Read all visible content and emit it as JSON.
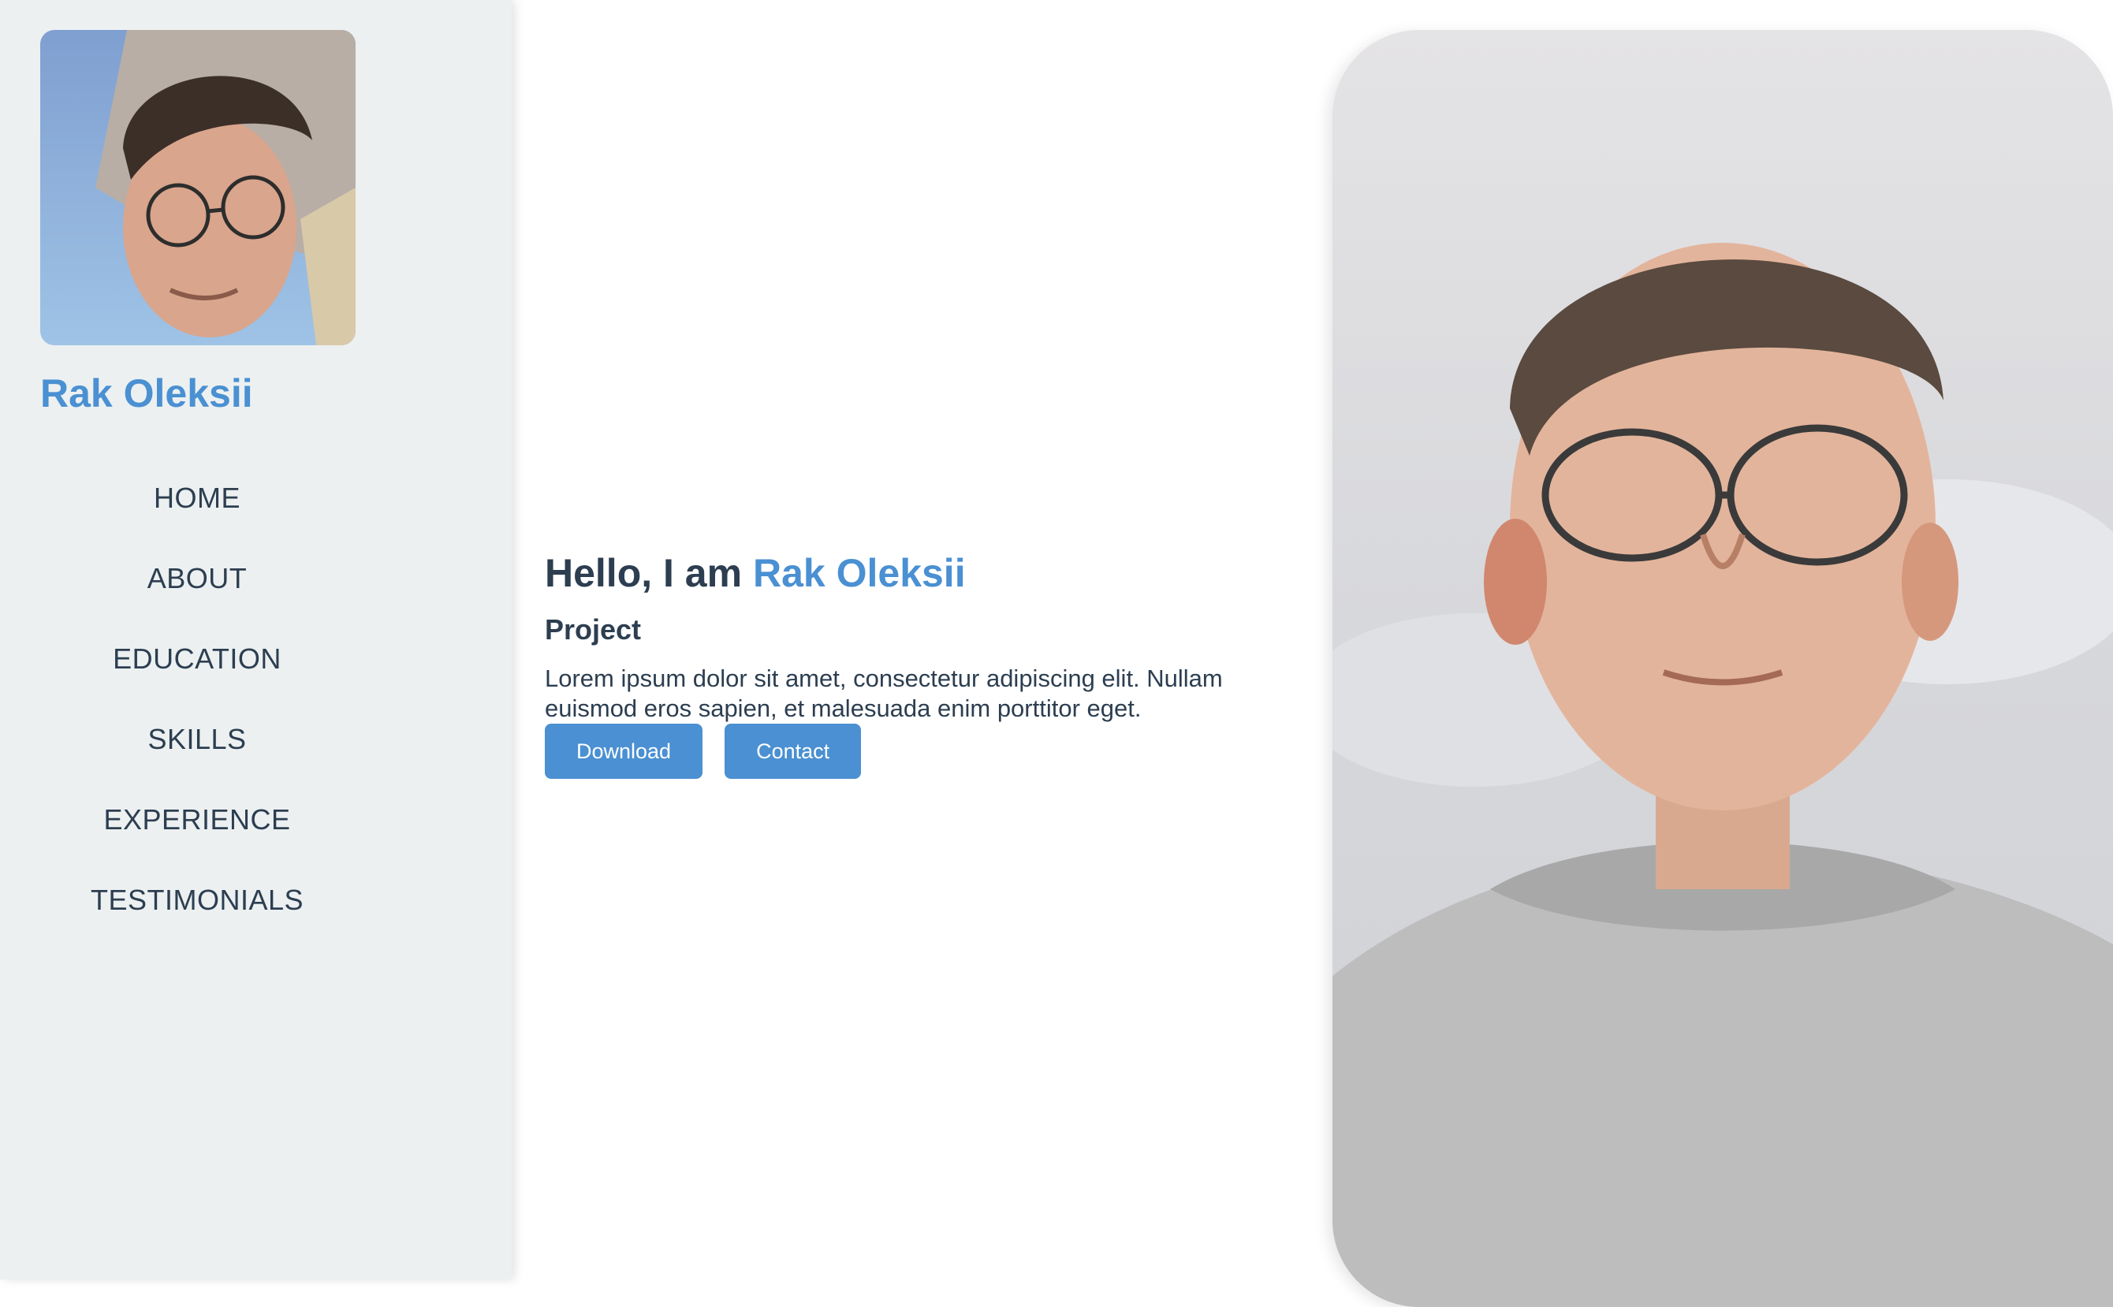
{
  "sidebar": {
    "name": "Rak Oleksii",
    "nav": [
      {
        "label": "HOME"
      },
      {
        "label": "ABOUT"
      },
      {
        "label": "EDUCATION"
      },
      {
        "label": "SKILLS"
      },
      {
        "label": "EXPERIENCE"
      },
      {
        "label": "TESTIMONIALS"
      }
    ]
  },
  "hero": {
    "greeting": "Hello, I am",
    "name": "Rak Oleksii",
    "subtitle": "Project",
    "description": "Lorem ipsum dolor sit amet, consectetur adipiscing elit. Nullam euismod eros sapien, et malesuada enim porttitor eget.",
    "download_label": "Download",
    "contact_label": "Contact"
  },
  "colors": {
    "accent": "#4a90d2",
    "text": "#2c3e50",
    "sidebar_bg": "#ecf0f1"
  }
}
